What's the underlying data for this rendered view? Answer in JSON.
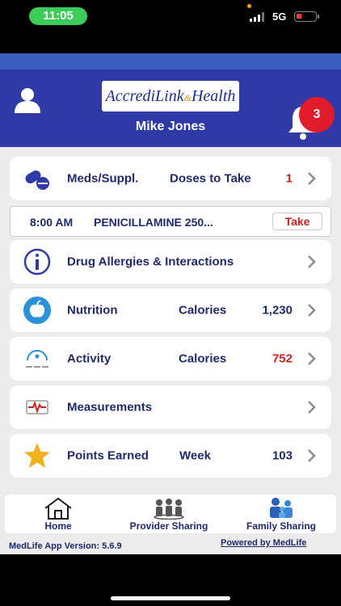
{
  "status_bar": {
    "time": "11:05",
    "network": "5G"
  },
  "header": {
    "logo_text": "AccrediLink",
    "logo_amp": "&",
    "logo_text2": "Health",
    "user_name": "Mike Jones",
    "notification_count": "3"
  },
  "meds": {
    "label": "Meds/Suppl.",
    "metric_label": "Doses to Take",
    "value": "1",
    "value_color": "#d21f1f"
  },
  "dose": {
    "time": "8:00 AM",
    "name": "PENICILLAMINE 250...",
    "action_label": "Take"
  },
  "cards": {
    "allergies": {
      "label": "Drug Allergies & Interactions"
    },
    "nutrition": {
      "label": "Nutrition",
      "metric_label": "Calories",
      "value": "1,230"
    },
    "activity": {
      "label": "Activity",
      "metric_label": "Calories",
      "value": "752"
    },
    "measurements": {
      "label": "Measurements"
    },
    "points": {
      "label": "Points Earned",
      "metric_label": "Week",
      "value": "103"
    }
  },
  "tabs": {
    "home": "Home",
    "provider": "Provider Sharing",
    "family": "Family Sharing"
  },
  "footer": {
    "version": "MedLife App Version: 5.6.9",
    "powered_by": "Powered by MedLife"
  },
  "icons": {
    "avatar": "person-icon",
    "bell": "bell-icon",
    "meds": "pill-icon",
    "allergies": "info-icon",
    "nutrition": "apple-icon",
    "activity": "activity-gauge-icon",
    "measurements": "heartbeat-icon",
    "points": "star-icon",
    "chevron": "chevron-right-icon"
  },
  "colors": {
    "header": "#2f3aa6",
    "header_top": "#3b5fbf",
    "text": "#1f2a6b",
    "alert": "#d21f1f",
    "badge": "#e21b2b",
    "time_pill": "#3ccc5a"
  }
}
